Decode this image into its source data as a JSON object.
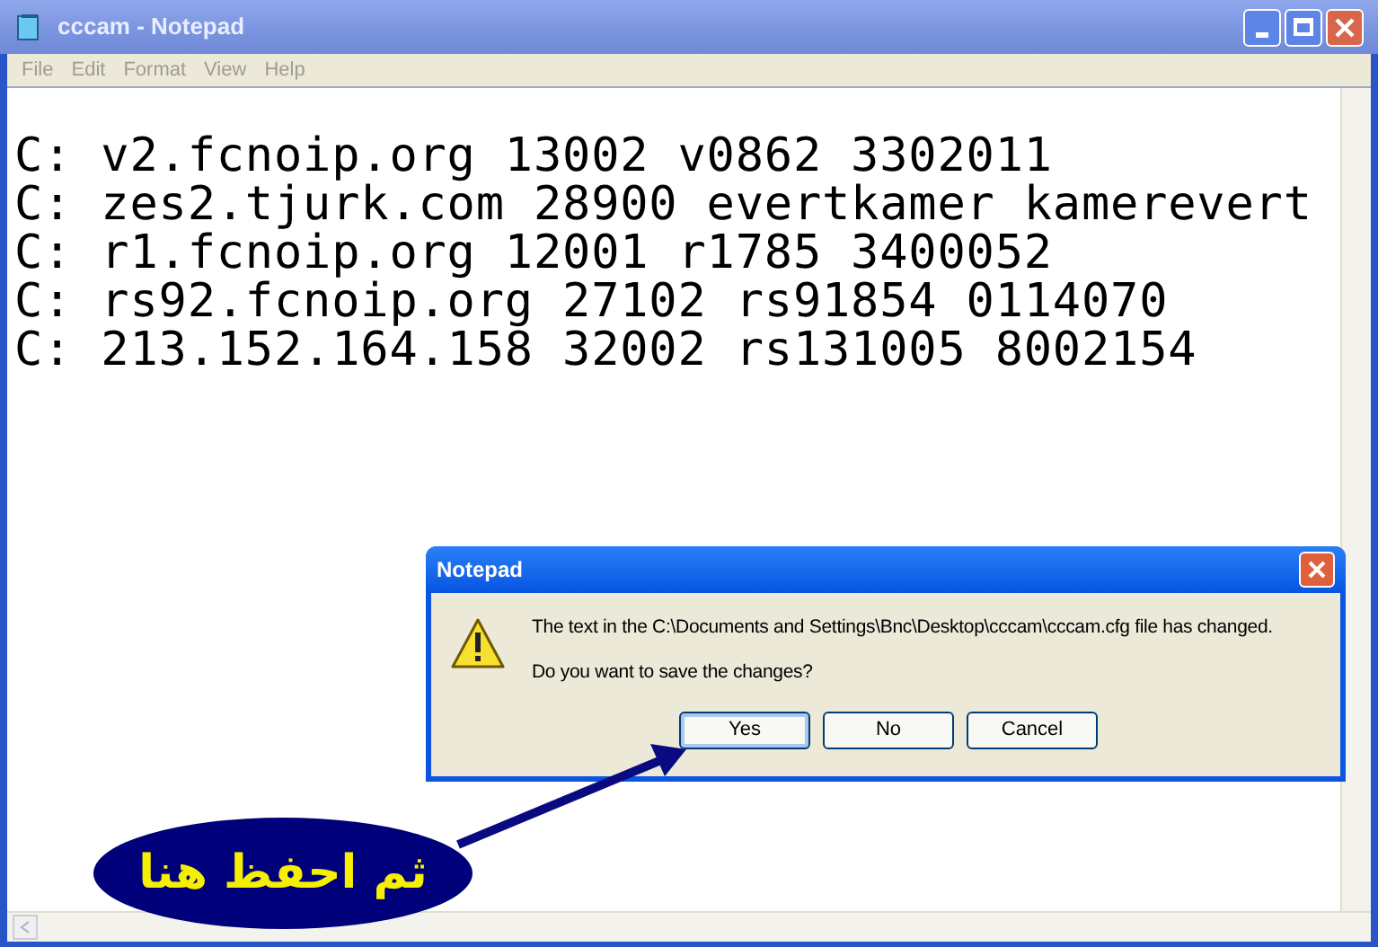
{
  "window": {
    "title": "cccam - Notepad"
  },
  "menu": [
    "File",
    "Edit",
    "Format",
    "View",
    "Help"
  ],
  "document_lines": [
    "C: v2.fcnoip.org 13002 v0862 3302011",
    "C: zes2.tjurk.com 28900 evertkamer kamerevert",
    "C: r1.fcnoip.org 12001 r1785 3400052",
    "C: rs92.fcnoip.org 27102 rs91854 0114070",
    "C: 213.152.164.158 32002 rs131005 8002154"
  ],
  "dialog": {
    "title": "Notepad",
    "message": "The text in the C:\\Documents and Settings\\Bnc\\Desktop\\cccam\\cccam.cfg file has changed.",
    "question": "Do you want to save the changes?",
    "buttons": [
      {
        "label": "Yes",
        "selected": true
      },
      {
        "label": "No",
        "selected": false
      },
      {
        "label": "Cancel",
        "selected": false
      }
    ]
  },
  "callout": {
    "text": "ثم احفظ هنا"
  }
}
